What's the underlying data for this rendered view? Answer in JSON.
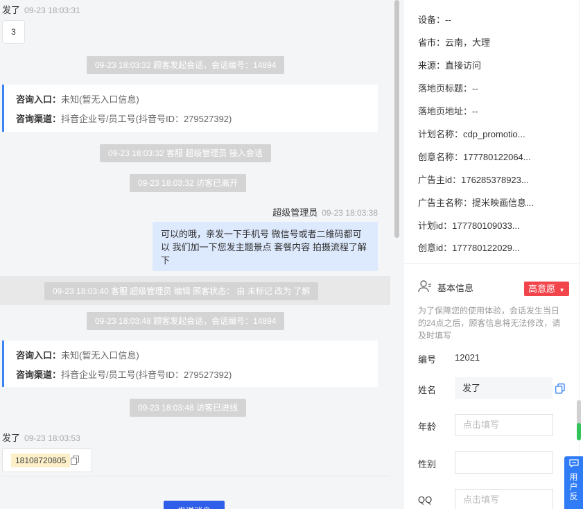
{
  "chat": {
    "msg1": {
      "sender": "发了",
      "time": "09-23 18:03:31",
      "text": "3"
    },
    "sys1": "09-23 18:03:32 顾客发起会话，会话编号：14894",
    "card1": {
      "entry_label": "咨询入口：",
      "entry_value": "未知(暂无入口信息)",
      "channel_label": "咨询渠道：",
      "channel_value": "抖音企业号/员工号(抖音号ID：279527392)"
    },
    "sys2": "09-23 18:03:32 客服 超级管理员 接入会话",
    "sys3": "09-23 18:03:32 访客已离开",
    "msg2": {
      "sender": "超级管理员",
      "time": "09-23 18:03:38",
      "text": "可以的哦，亲发一下手机号 微信号或者二维码都可以 我们加一下您发主题景点 套餐内容 拍摄流程了解下"
    },
    "sys4": "09-23 18:03:40 客服 超级管理员 编辑 顾客状态： 由 未标记 改为 了解",
    "sys5": "09-23 18:03:48 顾客发起会话，会话编号：14894",
    "card2": {
      "entry_label": "咨询入口：",
      "entry_value": "未知(暂无入口信息)",
      "channel_label": "咨询渠道：",
      "channel_value": "抖音企业号/员工号(抖音号ID：279527392)"
    },
    "sys6": "09-23 18:03:48 访客已进线",
    "msg3": {
      "sender": "发了",
      "time": "09-23 18:03:53",
      "text": "18108720805"
    },
    "send_label": "发送消息"
  },
  "side": {
    "fields": [
      {
        "label": "设备：",
        "value": "--"
      },
      {
        "label": "省市：",
        "value": "云南，大理"
      },
      {
        "label": "来源：",
        "value": "直接访问"
      },
      {
        "label": "落地页标题：",
        "value": "--"
      },
      {
        "label": "落地页地址：",
        "value": "--"
      },
      {
        "label": "计划名称：",
        "value": "cdp_promotio..."
      },
      {
        "label": "创意名称：",
        "value": "177780122064..."
      },
      {
        "label": "广告主id：",
        "value": "176285378923..."
      },
      {
        "label": "广告主名称：",
        "value": "提米映画信息..."
      },
      {
        "label": "计划id：",
        "value": "177780109033..."
      },
      {
        "label": "创意id：",
        "value": "177780122029..."
      }
    ],
    "basic_title": "基本信息",
    "intent": "高意愿",
    "notice": "为了保障您的使用体验，会话发生当日的24点之后，顾客信息将无法修改，请及时填写",
    "id_label": "编号",
    "id_value": "12021",
    "name_label": "姓名",
    "name_value": "发了",
    "age_label": "年龄",
    "age_placeholder": "点击填写",
    "gender_label": "性别",
    "qq_label": "QQ",
    "qq_placeholder": "点击填写",
    "feedback": "用户反"
  },
  "colors": {
    "accent": "#3c84f6",
    "intent": "#f2454b",
    "send": "#2f5ee8",
    "system": "#d4d4d4",
    "bubble_agent": "#dde9fd"
  }
}
